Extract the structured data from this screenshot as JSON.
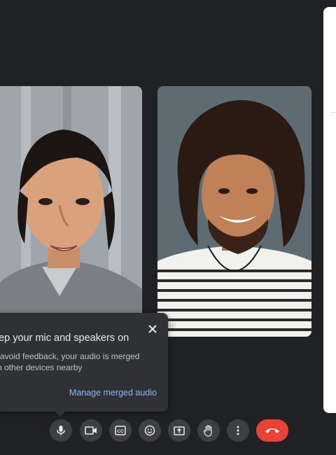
{
  "participants": [
    {
      "name": ""
    },
    {
      "name": "ou"
    }
  ],
  "popup": {
    "title": "eep your mic and speakers on",
    "body_line1": "o avoid feedback, your audio is merged",
    "body_line2": "ith other devices nearby",
    "link": "Manage merged audio"
  },
  "controls": {
    "items": [
      {
        "icon": "microphone-icon"
      },
      {
        "icon": "camera-icon"
      },
      {
        "icon": "captions-icon"
      },
      {
        "icon": "emoji-icon"
      },
      {
        "icon": "present-screen-icon"
      },
      {
        "icon": "raise-hand-icon"
      },
      {
        "icon": "more-options-icon"
      },
      {
        "icon": "end-call-icon"
      }
    ],
    "end_call_color": "#ea4335"
  },
  "colors": {
    "background": "#202124",
    "button": "#3c4043",
    "popup": "#303134",
    "link": "#8ab4f8"
  }
}
